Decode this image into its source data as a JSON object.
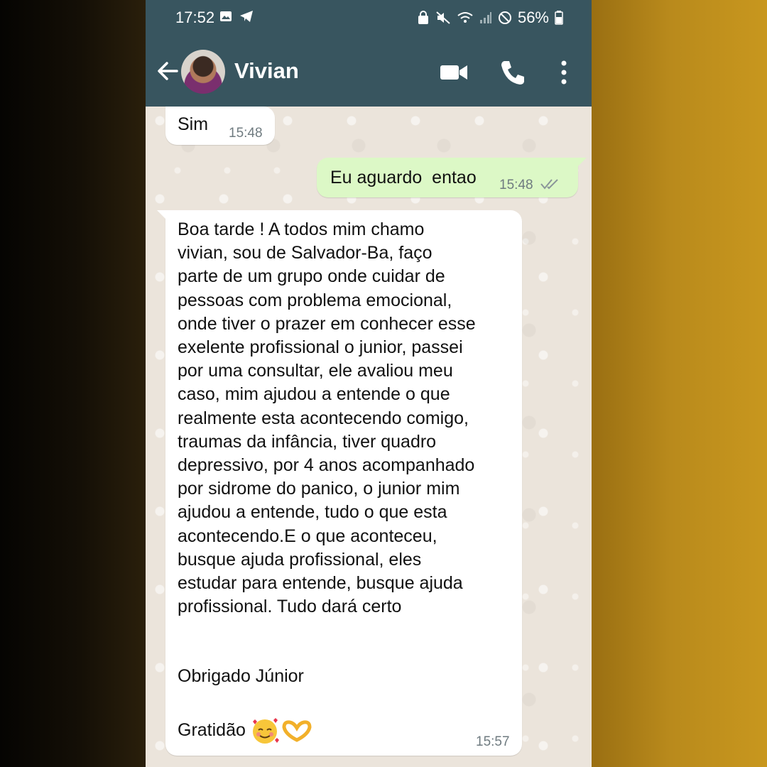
{
  "status_bar": {
    "time": "17:52",
    "battery": "56%"
  },
  "header": {
    "contact_name": "Vivian",
    "icons": [
      "back-arrow-icon",
      "video-call-icon",
      "phone-icon",
      "more-vertical-icon"
    ]
  },
  "messages": [
    {
      "direction": "incoming",
      "text": "Sim",
      "time": "15:48"
    },
    {
      "direction": "outgoing",
      "text": "Eu aguardo  entao",
      "time": "15:48",
      "status": "read"
    },
    {
      "direction": "incoming",
      "text": "Boa tarde ! A todos mim chamo\nvivian, sou de Salvador-Ba, faço\nparte de um grupo onde cuidar de\npessoas com problema emocional,\nonde tiver o prazer em conhecer esse\nexelente profissional o junior, passei\npor uma consultar, ele avaliou meu\ncaso, mim ajudou a entende o que\nrealmente esta acontecendo comigo,\ntraumas da infância, tiver quadro\ndepressivo, por 4 anos acompanhado\npor sidrome do panico, o junior mim\najudou a entende, tudo o que esta\nacontecendo.E o que aconteceu,\nbusque ajuda profissional, eles\nestudar para entende, busque ajuda\nprofissional. Tudo dará certo",
      "signoff": "Obrigado Júnior",
      "closing": "Gratidão",
      "emojis": [
        "smiling-face-with-hearts",
        "heart-hands"
      ],
      "time": "15:57"
    }
  ],
  "colors": {
    "header": "#38555f",
    "outgoing_bubble": "#dcf8c6",
    "incoming_bubble": "#ffffff",
    "chat_background": "#ebe4db",
    "read_ticks": "#8a9599"
  }
}
